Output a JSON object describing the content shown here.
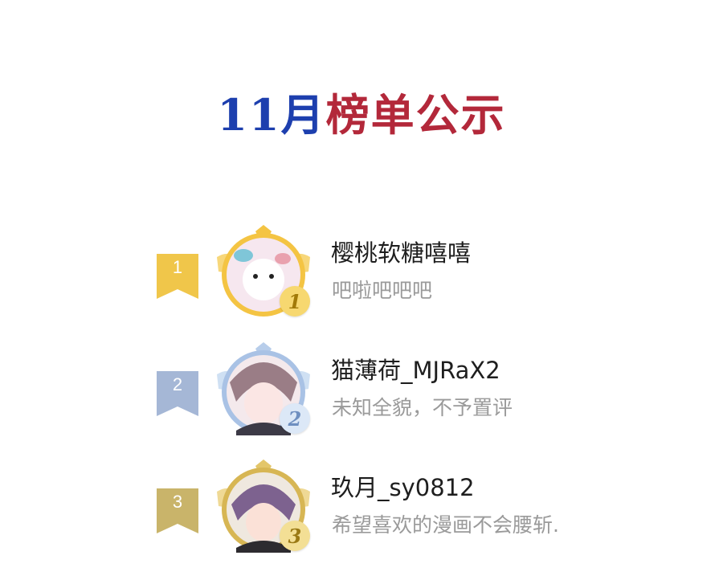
{
  "header": {
    "title_part1": "11月",
    "title_part2": "榜单公示"
  },
  "ranking": [
    {
      "rank": "1",
      "badge": "1",
      "username": "樱桃软糖嘻嘻",
      "bio": "吧啦吧吧吧",
      "ribbon_color": "#f0c64a",
      "frame_color": "#f4c443",
      "badge_color": "#e6b31e"
    },
    {
      "rank": "2",
      "badge": "2",
      "username": "猫薄荷_MJRaX2",
      "bio": "未知全貌，不予置评",
      "ribbon_color": "#9fb3d4",
      "frame_color": "#b7cdea",
      "badge_color": "#7ea0cf"
    },
    {
      "rank": "3",
      "badge": "3",
      "username": "玖月_sy0812",
      "bio": "希望喜欢的漫画不会腰斩.",
      "ribbon_color": "#c9b46a",
      "frame_color": "#e3c66a",
      "badge_color": "#c9a43c"
    }
  ]
}
